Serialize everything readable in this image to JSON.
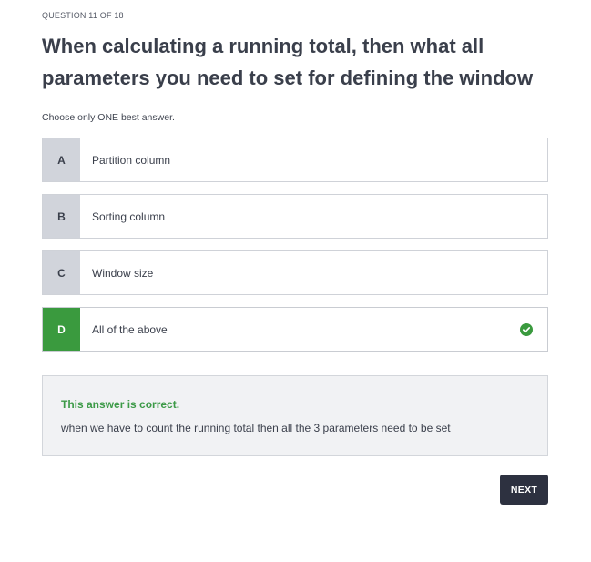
{
  "quiz": {
    "counter": "QUESTION 11 OF 18",
    "question": "When calculating a running total, then what all parameters you need to set for defining the window",
    "instruction": "Choose only ONE best answer.",
    "options": [
      {
        "letter": "A",
        "text": "Partition column"
      },
      {
        "letter": "B",
        "text": "Sorting column"
      },
      {
        "letter": "C",
        "text": "Window size"
      },
      {
        "letter": "D",
        "text": "All of the above"
      }
    ],
    "selected": "D",
    "feedback": {
      "title": "This answer is correct.",
      "body": "when we have to count the running total then all the 3 parameters need to be set"
    },
    "next_label": "NEXT"
  },
  "colors": {
    "correct": "#3a9a3e",
    "letter_bg": "#d1d4db",
    "button_bg": "#2d3140"
  },
  "icons": {
    "selected_indicator": "check-circle-icon"
  }
}
